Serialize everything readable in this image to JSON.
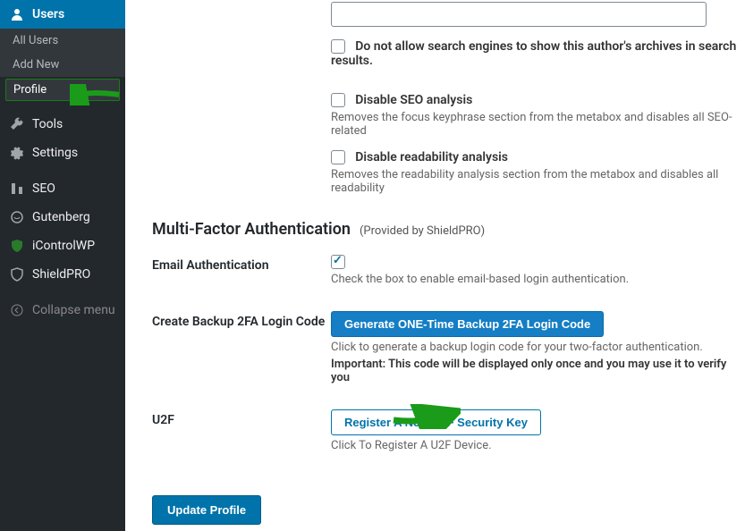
{
  "sidebar": {
    "active": "Users",
    "sub": {
      "all": "All Users",
      "add": "Add New",
      "profile": "Profile"
    },
    "items": {
      "tools": "Tools",
      "settings": "Settings",
      "seo": "SEO",
      "gutenberg": "Gutenberg",
      "icontrolwp": "iControlWP",
      "shieldpro": "ShieldPRO",
      "collapse": "Collapse menu"
    }
  },
  "seo": {
    "searchEngines": "Do not allow search engines to show this author's archives in search results.",
    "disableSeo": "Disable SEO analysis",
    "disableSeoHelp": "Removes the focus keyphrase section from the metabox and disables all SEO-related",
    "disableReadability": "Disable readability analysis",
    "disableReadabilityHelp": "Removes the readability analysis section from the metabox and disables all readability"
  },
  "mfa": {
    "title": "Multi-Factor Authentication",
    "provided": "(Provided by ShieldPRO)",
    "email": {
      "label": "Email Authentication",
      "help": "Check the box to enable email-based login authentication."
    },
    "backup": {
      "label": "Create Backup 2FA Login Code",
      "button": "Generate ONE-Time Backup 2FA Login Code",
      "help": "Click to generate a backup login code for your two-factor authentication.",
      "important": "Important: This code will be displayed only once and you may use it to verify you"
    },
    "u2f": {
      "label": "U2F",
      "button": "Register A New U2F Security Key",
      "help": "Click To Register A U2F Device."
    }
  },
  "update": "Update Profile"
}
